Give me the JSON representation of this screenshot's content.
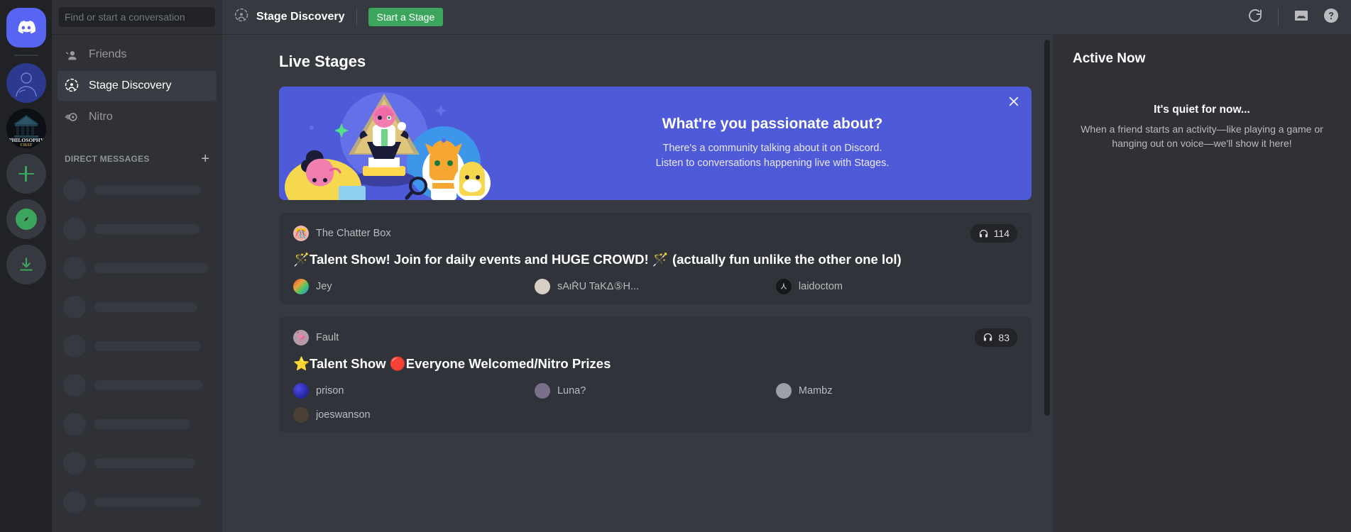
{
  "server_rail": {
    "items": [
      {
        "name": "discord-home",
        "icon": "discord-logo",
        "label": "Home"
      },
      {
        "name": "server-avatar-blue",
        "icon": "user-avatar",
        "label": ""
      },
      {
        "name": "server-philosophy-chat",
        "icon": "philosophy-chat-logo",
        "label": "THE PHILOSOPHY CHAT"
      },
      {
        "name": "add-server",
        "icon": "plus-icon",
        "label": "Add a Server"
      },
      {
        "name": "explore-servers",
        "icon": "compass-icon",
        "label": "Explore Public Servers"
      },
      {
        "name": "download-apps",
        "icon": "download-icon",
        "label": "Download Apps"
      }
    ]
  },
  "sidebar": {
    "search": {
      "placeholder": "Find or start a conversation",
      "value": ""
    },
    "nav": [
      {
        "label": "Friends",
        "icon": "friends-icon",
        "active": false
      },
      {
        "label": "Stage Discovery",
        "icon": "stage-icon",
        "active": true
      },
      {
        "label": "Nitro",
        "icon": "nitro-icon",
        "active": false
      }
    ],
    "dm_header": {
      "label": "Direct Messages",
      "add_label": "+"
    },
    "skeleton_widths": [
      150,
      148,
      160,
      145,
      150,
      152,
      135,
      142,
      150,
      140
    ]
  },
  "topbar": {
    "title": "Stage Discovery",
    "title_icon": "stage-icon",
    "start_stage_label": "Start a Stage",
    "icons": [
      {
        "name": "refresh-icon"
      },
      {
        "name": "inbox-icon"
      },
      {
        "name": "help-icon"
      }
    ]
  },
  "discovery": {
    "page_title": "Live Stages",
    "promo": {
      "title": "What're you passionate about?",
      "line1": "There's a community talking about it on Discord.",
      "line2": "Listen to conversations happening live with Stages.",
      "close_label": "×",
      "bg_color": "#4e5ad7"
    },
    "stages": [
      {
        "server_name": "The Chatter Box",
        "server_icon_emoji": "🎊",
        "listeners": "114",
        "listener_icon": "headphones-icon",
        "topic": "🪄Talent Show! Join for daily events and HUGE CROWD! 🪄 (actually fun unlike the other one lol)",
        "speakers": [
          {
            "name": "Jey",
            "avatar_color": "#c9793f",
            "avatar_initial": ""
          },
          {
            "name": "ѕAιŘU TaKΔ⑤H...",
            "avatar_color": "#d8cfc4",
            "avatar_initial": ""
          },
          {
            "name": "laidoctom",
            "avatar_color": "#16171a",
            "avatar_initial": "人"
          }
        ]
      },
      {
        "server_name": "Fault",
        "server_icon_emoji": "🦩",
        "listeners": "83",
        "listener_icon": "headphones-icon",
        "topic": "⭐Talent Show 🔴Everyone Welcomed/Nitro Prizes",
        "speakers": [
          {
            "name": "prison",
            "avatar_color": "#1c1ca8",
            "avatar_initial": ""
          },
          {
            "name": "Luna?",
            "avatar_color": "#7c6f8c",
            "avatar_initial": ""
          },
          {
            "name": "Mambz",
            "avatar_color": "#9aa0a6",
            "avatar_initial": ""
          },
          {
            "name": "joeswanson",
            "avatar_color": "#4a4036",
            "avatar_initial": ""
          }
        ]
      }
    ]
  },
  "active_now": {
    "title": "Active Now",
    "empty_title": "It's quiet for now...",
    "empty_body": "When a friend starts an activity—like playing a game or hanging out on voice—we'll show it here!"
  }
}
